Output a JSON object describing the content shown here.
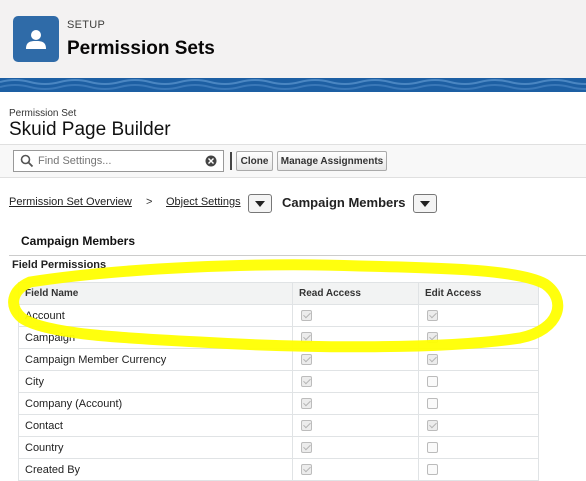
{
  "header": {
    "eyebrow": "SETUP",
    "title": "Permission Sets",
    "icon": "user-icon",
    "icon_color": "#2f6ba8"
  },
  "permission_set": {
    "label": "Permission Set",
    "name": "Skuid Page Builder"
  },
  "toolbar": {
    "search_placeholder": "Find Settings...",
    "clone_label": "Clone",
    "manage_label": "Manage Assignments"
  },
  "breadcrumb": {
    "overview_label": "Permission Set Overview",
    "object_settings_label": "Object Settings",
    "current_label": "Campaign Members",
    "separator": ">"
  },
  "section": {
    "title": "Campaign Members",
    "field_permissions_title": "Field Permissions"
  },
  "table": {
    "columns": [
      "Field Name",
      "Read Access",
      "Edit Access"
    ],
    "rows": [
      {
        "name": "Account",
        "read": true,
        "edit": true
      },
      {
        "name": "Campaign",
        "read": true,
        "edit": true
      },
      {
        "name": "Campaign Member Currency",
        "read": true,
        "edit": true
      },
      {
        "name": "City",
        "read": true,
        "edit": false
      },
      {
        "name": "Company (Account)",
        "read": true,
        "edit": false
      },
      {
        "name": "Contact",
        "read": true,
        "edit": true
      },
      {
        "name": "Country",
        "read": true,
        "edit": false
      },
      {
        "name": "Created By",
        "read": true,
        "edit": false
      }
    ]
  },
  "colors": {
    "highlight": "#ffff00",
    "banner": "#1d5fa3"
  }
}
